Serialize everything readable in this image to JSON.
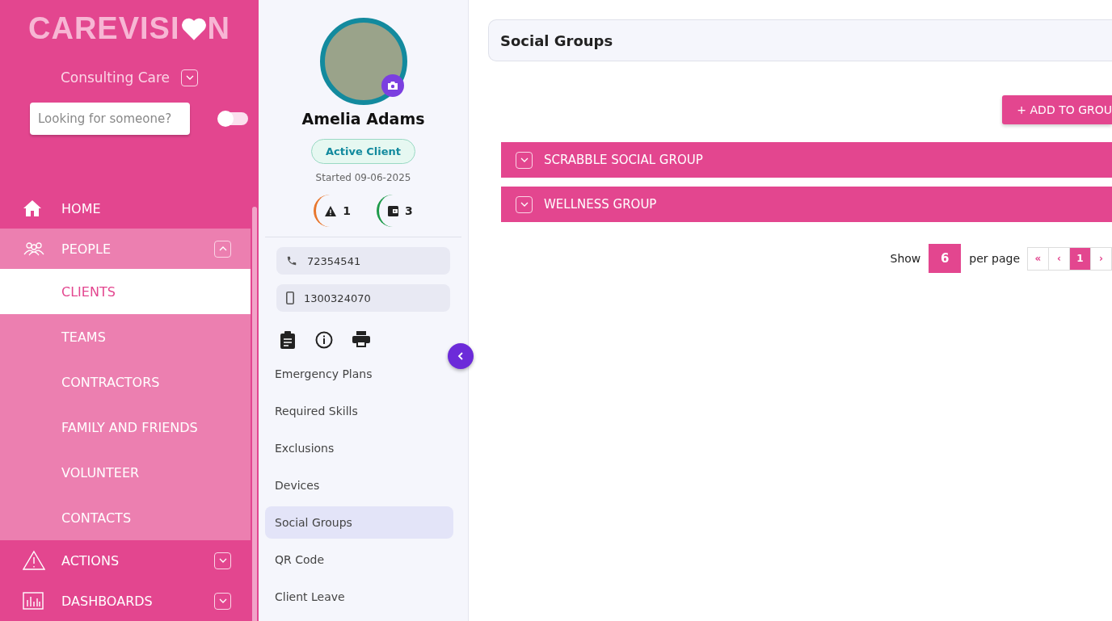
{
  "logo_text": [
    "CAREVISI",
    "N"
  ],
  "organisation": {
    "name": "Consulting Care",
    "expanded": false
  },
  "search": {
    "placeholder": "Looking for someone?"
  },
  "view_toggle": {
    "on": false
  },
  "nav": [
    {
      "label": "HOME",
      "kind": "home",
      "expanded": false
    },
    {
      "label": "PEOPLE",
      "kind": "people",
      "expanded": true,
      "children": [
        {
          "label": "CLIENTS",
          "selected": true
        },
        {
          "label": "TEAMS",
          "selected": false
        },
        {
          "label": "CONTRACTORS",
          "selected": false
        },
        {
          "label": "FAMILY AND FRIENDS",
          "selected": false
        },
        {
          "label": "VOLUNTEER",
          "selected": false
        },
        {
          "label": "CONTACTS",
          "selected": false
        }
      ]
    },
    {
      "label": "ACTIONS",
      "kind": "actions",
      "expanded": false
    },
    {
      "label": "DASHBOARDS",
      "kind": "dashboards",
      "expanded": false
    }
  ],
  "client": {
    "name": "Amelia Adams",
    "status": "Active Client",
    "started": "Started 09-06-2025",
    "counters": [
      {
        "kind": "alerts",
        "count": "1",
        "color": "#e8762c"
      },
      {
        "kind": "wallet",
        "count": "3",
        "color": "#1e9a4a"
      }
    ],
    "contacts": [
      {
        "kind": "phone",
        "value": "72354541"
      },
      {
        "kind": "mobile",
        "value": "1300324070"
      }
    ]
  },
  "client_menu": [
    {
      "label": "Emergency Plans",
      "selected": false
    },
    {
      "label": "Required Skills",
      "selected": false
    },
    {
      "label": "Exclusions",
      "selected": false
    },
    {
      "label": "Devices",
      "selected": false
    },
    {
      "label": "Social Groups",
      "selected": true
    },
    {
      "label": "QR Code",
      "selected": false
    },
    {
      "label": "Client Leave",
      "selected": false
    }
  ],
  "page_title": "Social Groups",
  "add_button": "+ ADD TO GROU",
  "groups": [
    {
      "name": "SCRABBLE SOCIAL GROUP",
      "expanded": false
    },
    {
      "name": "WELLNESS GROUP",
      "expanded": false
    }
  ],
  "pagination": {
    "show": "Show",
    "page_size": "6",
    "per_page": "per page",
    "pages": [
      {
        "label": "«",
        "selected": false
      },
      {
        "label": "‹",
        "selected": false
      },
      {
        "label": "1",
        "selected": true
      },
      {
        "label": "›",
        "selected": false
      }
    ]
  }
}
